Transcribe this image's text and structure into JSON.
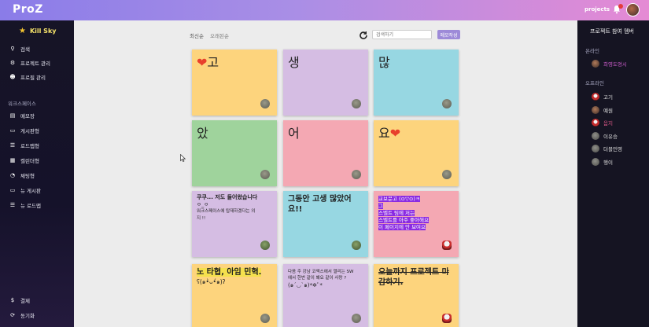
{
  "topbar": {
    "logo": "ProZ",
    "projects_label": "projects"
  },
  "sidebar": {
    "brand": "Kill Sky",
    "items": [
      {
        "label": "검색",
        "icon": "search-icon"
      },
      {
        "label": "프로젝트 관리",
        "icon": "gear-icon"
      },
      {
        "label": "프로필 관리",
        "icon": "user-icon"
      }
    ],
    "workspace_label": "워크스페이스",
    "workspace_items": [
      {
        "label": "메모장",
        "icon": "note-icon"
      },
      {
        "label": "게시판형",
        "icon": "board-icon"
      },
      {
        "label": "로드맵형",
        "icon": "roadmap-icon"
      },
      {
        "label": "캘린더형",
        "icon": "calendar-icon"
      },
      {
        "label": "채팅형",
        "icon": "chat-icon"
      },
      {
        "label": "뉴 게시판",
        "icon": "board-icon"
      },
      {
        "label": "뉴 로드맵",
        "icon": "roadmap-icon"
      }
    ],
    "bottom_items": [
      {
        "label": "결제",
        "icon": "dollar-icon"
      },
      {
        "label": "동기화",
        "icon": "sync-icon"
      }
    ]
  },
  "main": {
    "sort_tabs": [
      "최신순",
      "오래된순"
    ],
    "search_placeholder": "검색하기",
    "write_button": "메모작성",
    "notes": [
      {
        "text": "고",
        "color": "#fdd47d",
        "heart": "left"
      },
      {
        "text": "생",
        "color": "#d5bde3"
      },
      {
        "text": "많",
        "color": "#97d7e2"
      },
      {
        "text": "았",
        "color": "#9fd39c"
      },
      {
        "text": "어",
        "color": "#f4a8b3"
      },
      {
        "text": "요",
        "color": "#fdd47d",
        "heart": "right"
      },
      {
        "lines": [
          "쿠쿠... 저도 들어왔습니다",
          "ㅇ_ㅇ",
          "워크스페이스에 탑재하겠다는 의",
          "지 !!"
        ],
        "color": "#d5bde3"
      },
      {
        "lines": [
          "그동안 고생 많았어",
          "요!!"
        ],
        "color": "#97d7e2"
      },
      {
        "lines": [
          "교보문고 (⊙▽⊙)ㅋ",
          "그",
          "스벨트 팀에 저는",
          "스벨트를 아주 좋아해요",
          "이 페이지에 안 보여요"
        ],
        "color": "#f4a8b3"
      },
      {
        "lines": [
          "노 타협, 아임 민혁.",
          "ʕ(๑•̀ᴗ•́๑)ʔ"
        ],
        "color": "#fdd47d"
      },
      {
        "lines": [
          "다음 주 강남 코엑스에서 열리는 SW",
          "에서 한번 같이 봬요 같이 사랑 ?",
          "(๑´◡`๑)*✲ﾟ*"
        ],
        "color": "#d5bde3"
      },
      {
        "lines": [
          "오늘까지 프로젝트 마",
          "감하기."
        ],
        "color": "#fdd47d"
      }
    ]
  },
  "right_sidebar": {
    "title": "프로젝트 참여 멤버",
    "online_label": "온라인",
    "online_members": [
      {
        "name": "희영도엉시",
        "color": "#d15ed1"
      }
    ],
    "offline_label": "오프라인",
    "offline_members": [
      {
        "name": "고기",
        "color": "#e0e0e0"
      },
      {
        "name": "예원",
        "color": "#e0e0e0"
      },
      {
        "name": "음지",
        "color": "#e05a8a"
      },
      {
        "name": "이유승",
        "color": "#e0e0e0"
      },
      {
        "name": "더블민영",
        "color": "#e0e0e0"
      },
      {
        "name": "행이",
        "color": "#e0e0e0"
      }
    ]
  }
}
